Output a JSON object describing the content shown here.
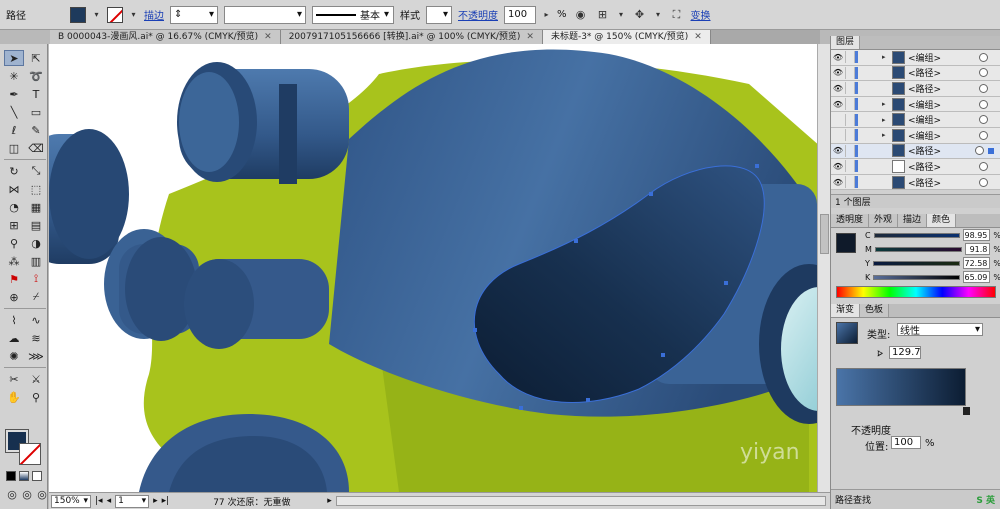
{
  "control_bar": {
    "selection_label": "路径",
    "stroke_label": "描边",
    "brush_label": "基本",
    "style_label": "样式",
    "opacity_label": "不透明度",
    "opacity_value": "100",
    "opacity_unit": "%",
    "transform_label": "变换"
  },
  "doc_tabs": [
    {
      "label": "B 0000043-漫画风.ai* @ 16.67% (CMYK/预览)"
    },
    {
      "label": "2007917105156666 [转换].ai* @ 100% (CMYK/预览)"
    },
    {
      "label": "未标题-3* @ 150% (CMYK/预览)"
    }
  ],
  "status": {
    "zoom": "150%",
    "page": "1",
    "message": "77 次还原：无重做"
  },
  "layers": {
    "title": "图层",
    "rows": [
      "<编组>",
      "<路径>",
      "<路径>",
      "<编组>",
      "<编组>",
      "<编组>",
      "<路径>",
      "<路径>",
      "<路径>"
    ],
    "footer": "1 个图层"
  },
  "color_panel": {
    "tabs": [
      "透明度",
      "外观",
      "描边",
      "颜色"
    ],
    "channels": [
      {
        "label": "C",
        "value": "98.95"
      },
      {
        "label": "M",
        "value": "91.8"
      },
      {
        "label": "Y",
        "value": "72.58"
      },
      {
        "label": "K",
        "value": "65.09"
      }
    ],
    "unit": "%"
  },
  "gradient_panel": {
    "tabs": [
      "渐变",
      "色板"
    ],
    "type_label": "类型:",
    "type_value": "线性",
    "angle_value": "129.7",
    "opacity_label": "不透明度",
    "position_label": "位置:",
    "position_value": "100",
    "unit": "%"
  },
  "pathfinder": {
    "label": "路径查找"
  },
  "colors": {
    "accent_fill": "#17304f",
    "body_blue": "#3f6a9c",
    "green": "#a8c31c",
    "selection": "#3a6fd8"
  },
  "watermark": "yiyan"
}
